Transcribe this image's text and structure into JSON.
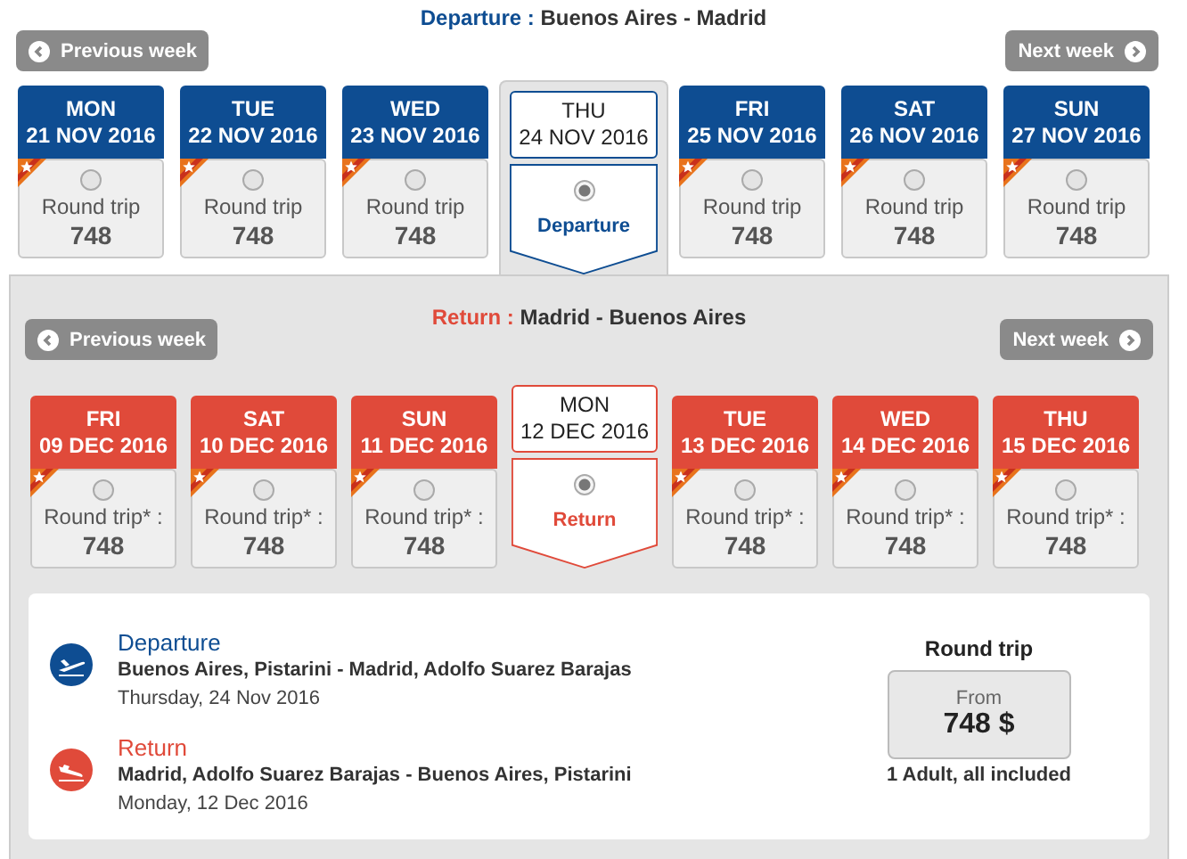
{
  "departure": {
    "kind": "departure",
    "label": "Departure :",
    "route": "Buenos Aires - Madrid",
    "previous": "Previous week",
    "next": "Next week",
    "days": [
      {
        "weekday": "MON",
        "date": "21 NOV 2016",
        "selected": false,
        "fare_label": "Round trip",
        "price": "748"
      },
      {
        "weekday": "TUE",
        "date": "22 NOV 2016",
        "selected": false,
        "fare_label": "Round trip",
        "price": "748"
      },
      {
        "weekday": "WED",
        "date": "23 NOV 2016",
        "selected": false,
        "fare_label": "Round trip",
        "price": "748"
      },
      {
        "weekday": "THU",
        "date": "24 NOV 2016",
        "selected": true,
        "fare_label": "Departure"
      },
      {
        "weekday": "FRI",
        "date": "25 NOV 2016",
        "selected": false,
        "fare_label": "Round trip",
        "price": "748"
      },
      {
        "weekday": "SAT",
        "date": "26 NOV 2016",
        "selected": false,
        "fare_label": "Round trip",
        "price": "748"
      },
      {
        "weekday": "SUN",
        "date": "27 NOV 2016",
        "selected": false,
        "fare_label": "Round trip",
        "price": "748"
      }
    ]
  },
  "return": {
    "kind": "return",
    "label": "Return :",
    "route": "Madrid - Buenos Aires",
    "previous": "Previous week",
    "next": "Next week",
    "days": [
      {
        "weekday": "FRI",
        "date": "09 DEC 2016",
        "selected": false,
        "fare_label": "Round trip* :",
        "price": "748"
      },
      {
        "weekday": "SAT",
        "date": "10 DEC 2016",
        "selected": false,
        "fare_label": "Round trip* :",
        "price": "748"
      },
      {
        "weekday": "SUN",
        "date": "11 DEC 2016",
        "selected": false,
        "fare_label": "Round trip* :",
        "price": "748"
      },
      {
        "weekday": "MON",
        "date": "12 DEC 2016",
        "selected": true,
        "fare_label": "Return"
      },
      {
        "weekday": "TUE",
        "date": "13 DEC 2016",
        "selected": false,
        "fare_label": "Round trip* :",
        "price": "748"
      },
      {
        "weekday": "WED",
        "date": "14 DEC 2016",
        "selected": false,
        "fare_label": "Round trip* :",
        "price": "748"
      },
      {
        "weekday": "THU",
        "date": "15 DEC 2016",
        "selected": false,
        "fare_label": "Round trip* :",
        "price": "748"
      }
    ]
  },
  "summary": {
    "legs": [
      {
        "kind": "departure",
        "title": "Departure",
        "route": "Buenos Aires, Pistarini - Madrid, Adolfo Suarez Barajas",
        "date": "Thursday, 24 Nov 2016"
      },
      {
        "kind": "return",
        "title": "Return",
        "route": "Madrid, Adolfo Suarez Barajas - Buenos Aires, Pistarini",
        "date": "Monday, 12 Dec 2016"
      }
    ],
    "heading": "Round trip",
    "from": "From",
    "price": "748 $",
    "note": "1 Adult, all included"
  }
}
